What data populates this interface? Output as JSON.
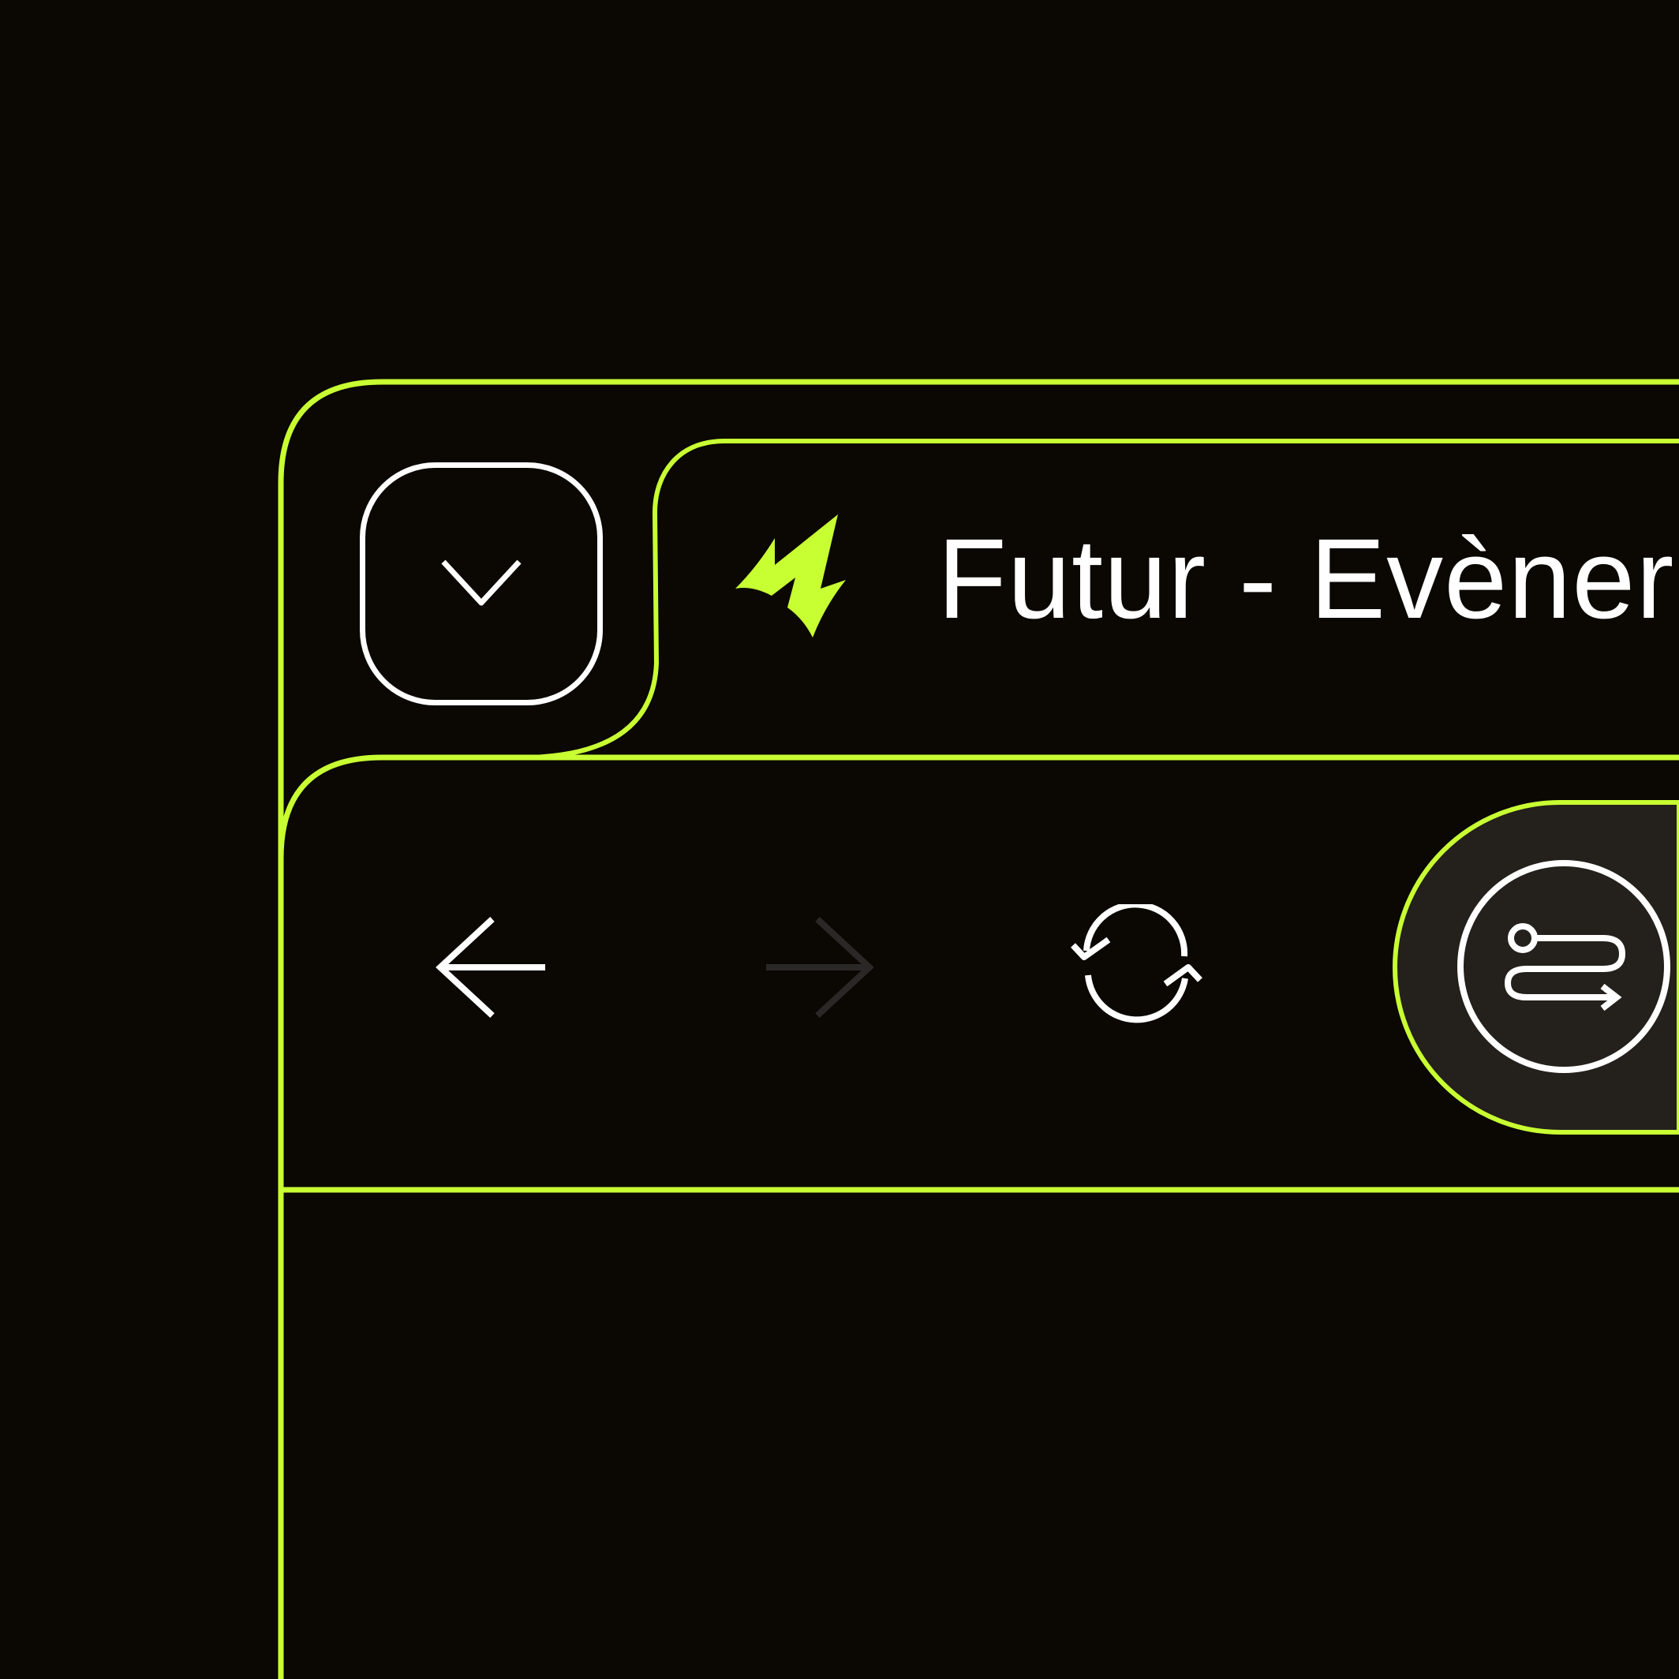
{
  "tab": {
    "title": "Futur - Evèner"
  },
  "toolbar": {
    "menu_icon": "chevron-down-icon",
    "favicon": "lightning-bolt-icon",
    "back_icon": "arrow-left-icon",
    "forward_icon": "arrow-right-icon",
    "forward_enabled": false,
    "reload_icon": "refresh-icon",
    "route_icon": "route-icon"
  },
  "colors": {
    "background": "#0b0703",
    "accent": "#c8ff32",
    "foreground": "#ffffff",
    "disabled": "#2a2826",
    "pill_fill": "#24201b"
  }
}
